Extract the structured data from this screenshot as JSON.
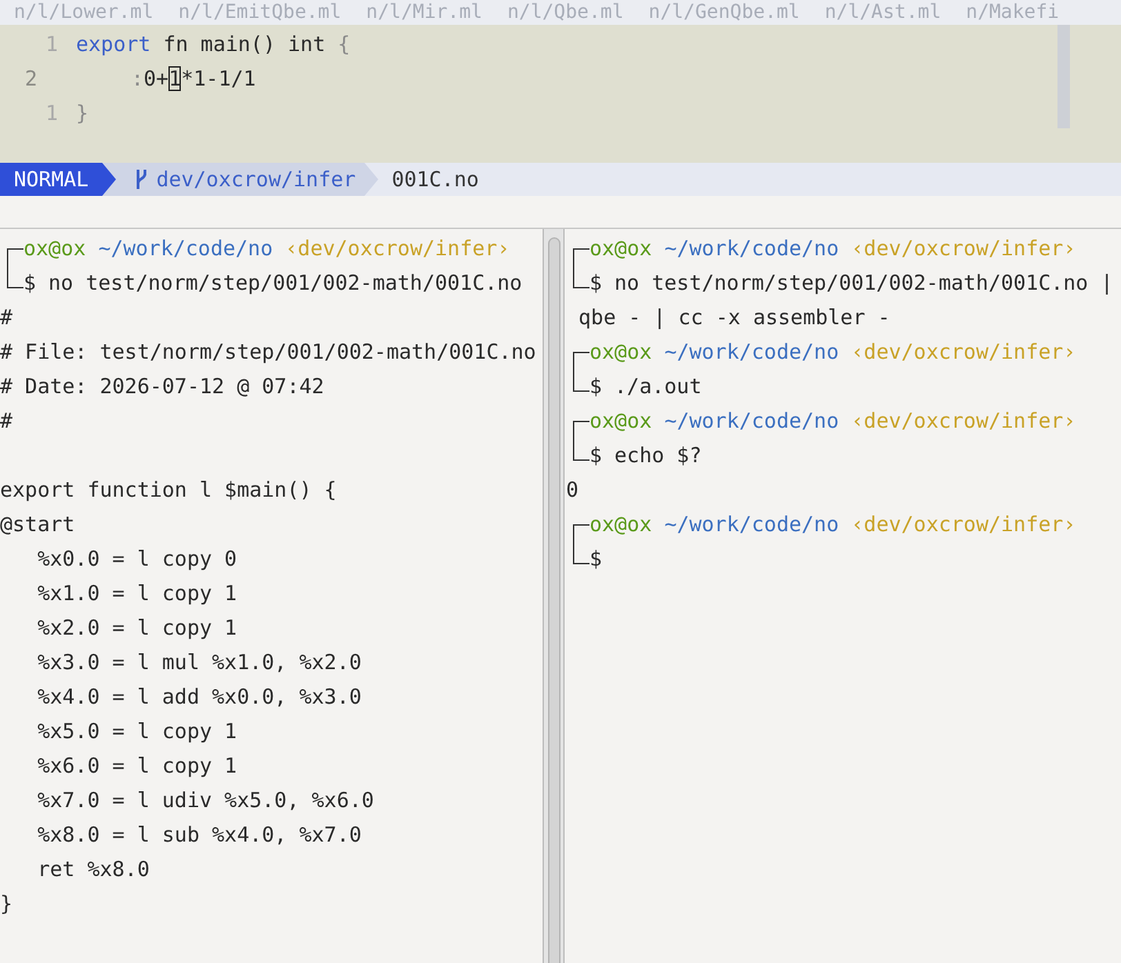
{
  "tabs": [
    "n/l/Lower.ml",
    "n/l/EmitQbe.ml",
    "n/l/Mir.ml",
    "n/l/Qbe.ml",
    "n/l/GenQbe.ml",
    "n/l/Ast.ml",
    "n/Makefi"
  ],
  "editor": {
    "lines": [
      {
        "number": "1",
        "current": false,
        "segments": [
          {
            "kind": "keyword",
            "text": "export"
          },
          {
            "kind": "plain",
            "text": " fn main() int "
          },
          {
            "kind": "punct",
            "text": "{"
          }
        ]
      },
      {
        "number": "2",
        "current": true,
        "segments": [
          {
            "kind": "punct",
            "text": ":"
          },
          {
            "kind": "plain",
            "text": "0+"
          },
          {
            "kind": "cursor",
            "text": "1"
          },
          {
            "kind": "plain",
            "text": "*1-1/1"
          }
        ]
      },
      {
        "number": "1",
        "current": false,
        "segments": [
          {
            "kind": "punct",
            "text": "}"
          }
        ]
      }
    ]
  },
  "statusline": {
    "mode": "NORMAL",
    "branch": "dev/oxcrow/infer",
    "file": "001C.no"
  },
  "panes": [
    {
      "lines": [
        {
          "kind": "prompt",
          "user": "ox@ox",
          "path": "~/work/code/no",
          "branch": "‹dev/oxcrow/infer›",
          "symbol": "$",
          "command": "no test/norm/step/001/002-math/001C.no"
        },
        {
          "kind": "output",
          "text": "#"
        },
        {
          "kind": "output",
          "text": "# File: test/norm/step/001/002-math/001C.no"
        },
        {
          "kind": "output",
          "text": "# Date: 2026-07-12 @ 07:42"
        },
        {
          "kind": "output",
          "text": "#"
        },
        {
          "kind": "blank"
        },
        {
          "kind": "output",
          "text": "export function l $main() {"
        },
        {
          "kind": "output",
          "text": "@start"
        },
        {
          "kind": "output",
          "text": "   %x0.0 = l copy 0"
        },
        {
          "kind": "output",
          "text": "   %x1.0 = l copy 1"
        },
        {
          "kind": "output",
          "text": "   %x2.0 = l copy 1"
        },
        {
          "kind": "output",
          "text": "   %x3.0 = l mul %x1.0, %x2.0"
        },
        {
          "kind": "output",
          "text": "   %x4.0 = l add %x0.0, %x3.0"
        },
        {
          "kind": "output",
          "text": "   %x5.0 = l copy 1"
        },
        {
          "kind": "output",
          "text": "   %x6.0 = l copy 1"
        },
        {
          "kind": "output",
          "text": "   %x7.0 = l udiv %x5.0, %x6.0"
        },
        {
          "kind": "output",
          "text": "   %x8.0 = l sub %x4.0, %x7.0"
        },
        {
          "kind": "output",
          "text": "   ret %x8.0"
        },
        {
          "kind": "output",
          "text": "}"
        }
      ]
    },
    {
      "lines": [
        {
          "kind": "prompt",
          "user": "ox@ox",
          "path": "~/work/code/no",
          "branch": "‹dev/oxcrow/infer›",
          "symbol": "$",
          "command": "no test/norm/step/001/002-math/001C.no |"
        },
        {
          "kind": "output",
          "text": " qbe - | cc -x assembler -"
        },
        {
          "kind": "prompt",
          "user": "ox@ox",
          "path": "~/work/code/no",
          "branch": "‹dev/oxcrow/infer›",
          "symbol": "$",
          "command": "./a.out"
        },
        {
          "kind": "prompt",
          "user": "ox@ox",
          "path": "~/work/code/no",
          "branch": "‹dev/oxcrow/infer›",
          "symbol": "$",
          "command": "echo $?"
        },
        {
          "kind": "output",
          "text": "0"
        },
        {
          "kind": "prompt",
          "user": "ox@ox",
          "path": "~/work/code/no",
          "branch": "‹dev/oxcrow/infer›",
          "symbol": "$"
        }
      ]
    }
  ]
}
